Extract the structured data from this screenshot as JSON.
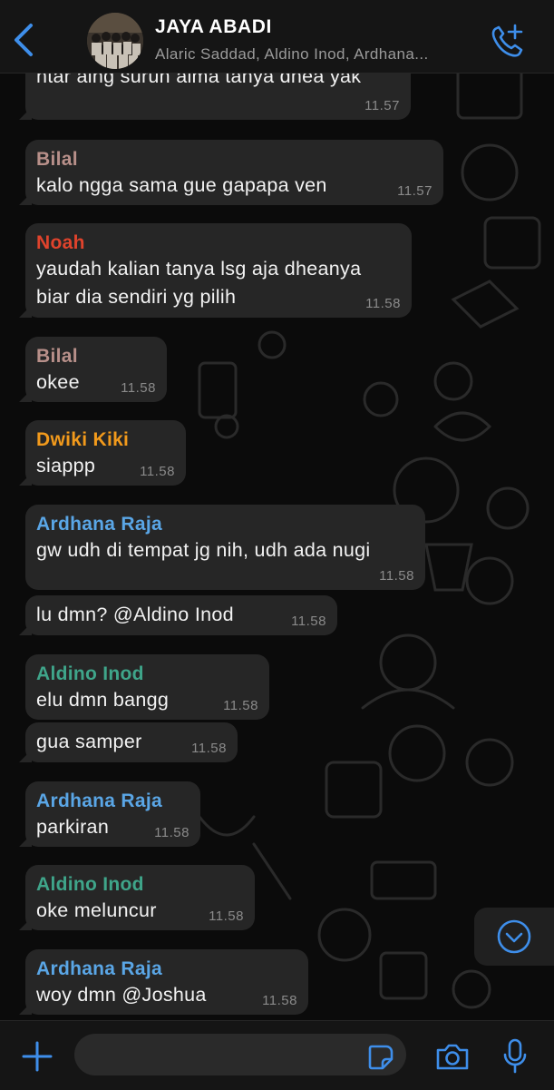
{
  "header": {
    "title": "JAYA ABADI",
    "members": "Alaric Saddad, Aldino Inod, Ardhana...",
    "back_icon": "chevron-left-icon",
    "call_icon": "phone-plus-icon",
    "accent": "#3e8eea"
  },
  "messages": [
    {
      "sender": "",
      "sender_color": "",
      "text": "ntar aing suruh alma tanya dhea yak",
      "time": "11.57"
    },
    {
      "sender": "Bilal",
      "sender_color": "#b8908a",
      "text": "kalo ngga sama gue gapapa ven",
      "time": "11.57"
    },
    {
      "sender": "Noah",
      "sender_color": "#e0432c",
      "text": "yaudah kalian tanya lsg aja dheanya",
      "text2": "biar dia sendiri yg pilih",
      "time": "11.58"
    },
    {
      "sender": "Bilal",
      "sender_color": "#b8908a",
      "text": "okee",
      "time": "11.58"
    },
    {
      "sender": "Dwiki Kiki",
      "sender_color": "#f29a1c",
      "text": "siappp",
      "time": "11.58"
    },
    {
      "sender": "Ardhana Raja",
      "sender_color": "#5aa6e6",
      "text": "gw udh di tempat jg nih, udh ada nugi",
      "time": "11.58"
    },
    {
      "sender": "",
      "sender_color": "",
      "text": "lu dmn? @Aldino Inod",
      "time": "11.58"
    },
    {
      "sender": "Aldino Inod",
      "sender_color": "#3fa58a",
      "text": "elu dmn bangg",
      "time": "11.58"
    },
    {
      "sender": "",
      "sender_color": "",
      "text": "gua samper",
      "time": "11.58"
    },
    {
      "sender": "Ardhana Raja",
      "sender_color": "#5aa6e6",
      "text": "parkiran",
      "time": "11.58"
    },
    {
      "sender": "Aldino Inod",
      "sender_color": "#3fa58a",
      "text": "oke meluncur",
      "time": "11.58"
    },
    {
      "sender": "Ardhana Raja",
      "sender_color": "#5aa6e6",
      "text": "woy dmn @Joshua",
      "time": "11.58"
    }
  ],
  "input": {
    "placeholder": "",
    "value": "",
    "icons": [
      "plus-icon",
      "sticker-icon",
      "camera-icon",
      "microphone-icon"
    ]
  },
  "scroll_icon": "chevron-down-icon"
}
